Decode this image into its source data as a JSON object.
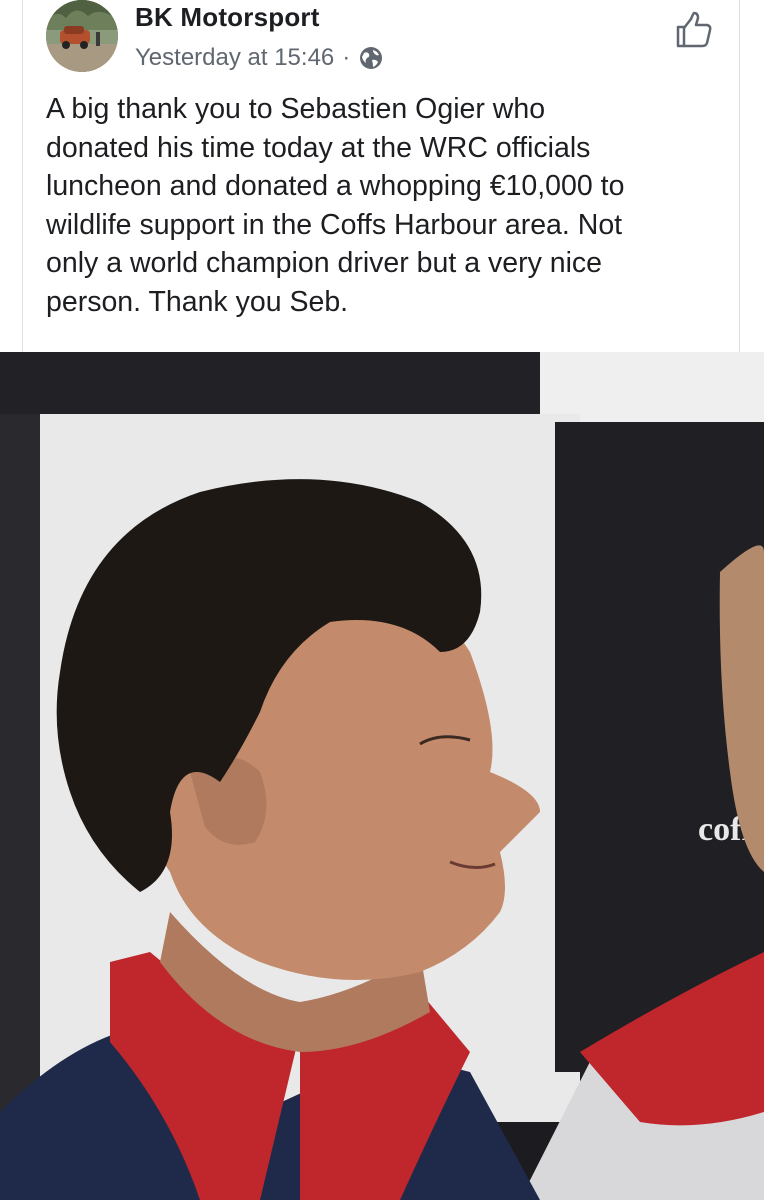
{
  "post": {
    "page_name": "BK Motorsport",
    "timestamp": "Yesterday at 15:46",
    "separator": "·",
    "privacy_icon": "globe-icon",
    "like_icon": "thumbs-up-icon",
    "text_lines": [
      "A big thank you to Sebastien Ogier who",
      "donated his time today at the WRC officials",
      "luncheon and donated a whopping €10,000 to",
      "wildlife support in the Coffs Harbour area. Not",
      "only a world champion driver but a very nice",
      "person. Thank you Seb."
    ]
  },
  "photo": {
    "backdrop_text": "coffs",
    "colors": {
      "backdrop_black": "#1e1e22",
      "backdrop_white": "#eeeeee",
      "shirt_red": "#c0272d",
      "shirt_navy": "#1f2a4a"
    }
  }
}
